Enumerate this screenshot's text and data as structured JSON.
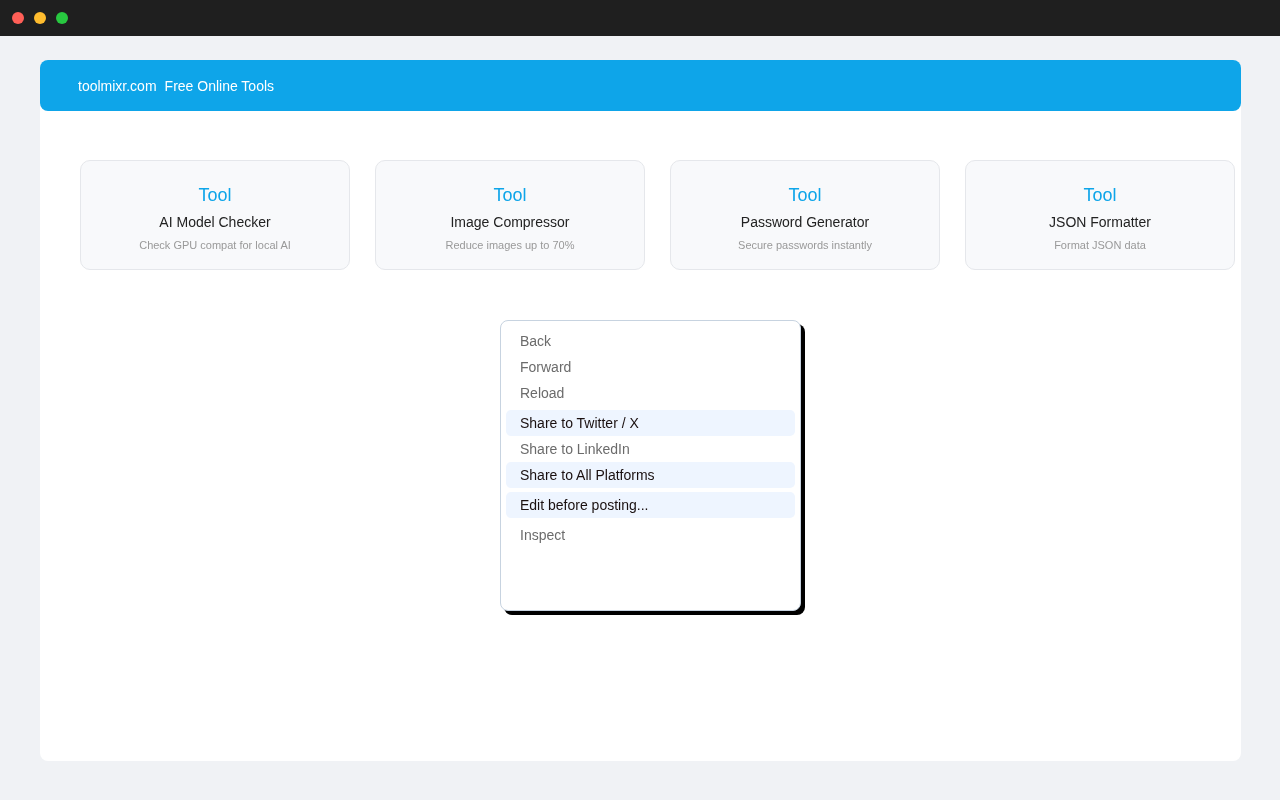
{
  "header": {
    "site": "toolmixr.com",
    "tagline": "Free Online Tools"
  },
  "tools": [
    {
      "tag": "Tool",
      "name": "AI Model Checker",
      "description": "Check GPU compat for local AI"
    },
    {
      "tag": "Tool",
      "name": "Image Compressor",
      "description": "Reduce images up to 70%"
    },
    {
      "tag": "Tool",
      "name": "Password Generator",
      "description": "Secure passwords instantly"
    },
    {
      "tag": "Tool",
      "name": "JSON Formatter",
      "description": "Format JSON data"
    }
  ],
  "context_menu": {
    "groups": [
      {
        "items": [
          {
            "label": "Back",
            "highlighted": false
          },
          {
            "label": "Forward",
            "highlighted": false
          },
          {
            "label": "Reload",
            "highlighted": false
          }
        ]
      },
      {
        "items": [
          {
            "label": "Share to Twitter / X",
            "highlighted": true
          },
          {
            "label": "Share to LinkedIn",
            "highlighted": false
          },
          {
            "label": "Share to All Platforms",
            "highlighted": true
          }
        ]
      },
      {
        "items": [
          {
            "label": "Edit before posting...",
            "highlighted": true
          }
        ]
      },
      {
        "items": [
          {
            "label": "Inspect",
            "highlighted": false
          }
        ]
      }
    ]
  }
}
